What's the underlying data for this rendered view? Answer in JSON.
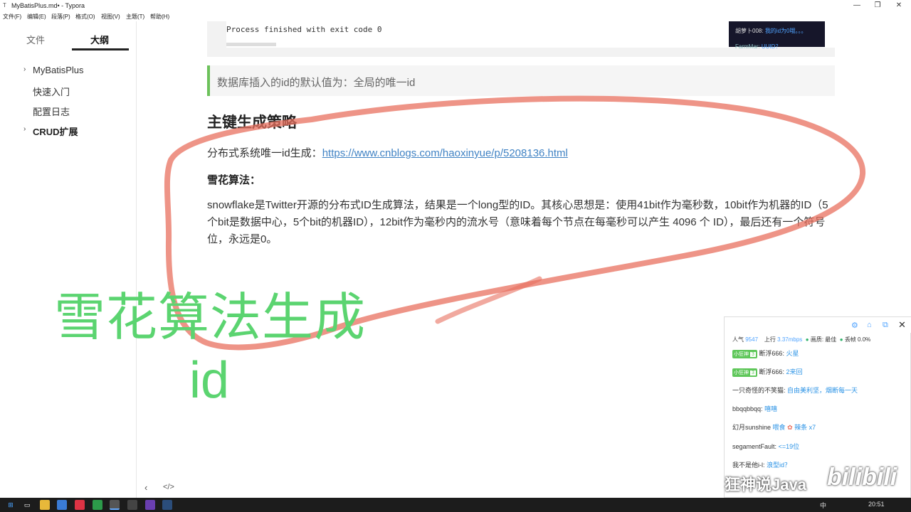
{
  "window": {
    "title": "MyBatisPlus.md• - Typora",
    "app_glyph": "T",
    "min": "—",
    "max": "❐",
    "close": "✕"
  },
  "menu": [
    "文件(F)",
    "编辑(E)",
    "段落(P)",
    "格式(O)",
    "视图(V)",
    "主题(T)",
    "帮助(H)"
  ],
  "sidebar": {
    "tabs": {
      "files": "文件",
      "outline": "大纲"
    },
    "items": [
      {
        "label": "MyBatisPlus",
        "arrow": "›"
      },
      {
        "label": "快速入门"
      },
      {
        "label": "配置日志"
      },
      {
        "label": "CRUD扩展",
        "arrow": "›"
      }
    ],
    "bottom": {
      "back": "‹",
      "source": "</>"
    }
  },
  "editor": {
    "code_line": "Process finished with exit code 0",
    "quote": "数据库插入的id的默认值为：全局的唯一id",
    "heading": "主键生成策略",
    "para1_prefix": "分布式系统唯一id生成：",
    "para1_link": "https://www.cnblogs.com/haoxinyue/p/5208136.html",
    "subheading": "雪花算法：",
    "para2": "snowflake是Twitter开源的分布式ID生成算法，结果是一个long型的ID。其核心思想是：使用41bit作为毫秒数，10bit作为机器的ID（5个bit是数据中心，5个bit的机器ID），12bit作为毫秒内的流水号（意味着每个节点在每毫秒可以产生 4096 个 ID），最后还有一个符号位，永远是0。"
  },
  "overlay": {
    "line1": "雪花算法生成",
    "line2": "id"
  },
  "mini_chat": {
    "line1_user": "胡萝卜008:",
    "line1_msg": "我的id为0哦。。。",
    "line2_user": "FarmMar:",
    "line2_msg": "UUID？"
  },
  "live_panel": {
    "icons": {
      "settings": "⚙",
      "lock": "⌂",
      "popout": "⧉",
      "close": "✕"
    },
    "stats": {
      "popularity_label": "人气",
      "popularity": "9547",
      "upload_label": "上行",
      "upload": "3.37mbps",
      "quality_label": "画质: 最佳",
      "drop_label": "丢帧 0.0%"
    },
    "messages": [
      {
        "medal": "小狂神",
        "level": "3",
        "user": "断浮666:",
        "text": "火星"
      },
      {
        "medal": "小狂神",
        "level": "3",
        "user": "断浮666:",
        "text": "2来回"
      },
      {
        "user": "一只奇怪的不笑猫:",
        "text": "自由美利坚，烟断每一天"
      },
      {
        "user": "bbqqbbqq:",
        "text": "嘻嘻"
      },
      {
        "user": "幻月sunshine",
        "text": "喂食",
        "gift": "辣条 x7"
      },
      {
        "user": "segamentFault:",
        "text": "<=19位"
      },
      {
        "user": "我不是他i-l:",
        "text": "浪型id？"
      }
    ]
  },
  "watermark": {
    "text": "狂神说Java",
    "logo": "bilibili"
  },
  "taskbar": {
    "time": "20:51",
    "ime": "中"
  },
  "colors": {
    "accent_green": "#5bd470",
    "ink_red": "#e8705f",
    "link": "#4183c4",
    "quote_bar": "#6cc15a"
  }
}
